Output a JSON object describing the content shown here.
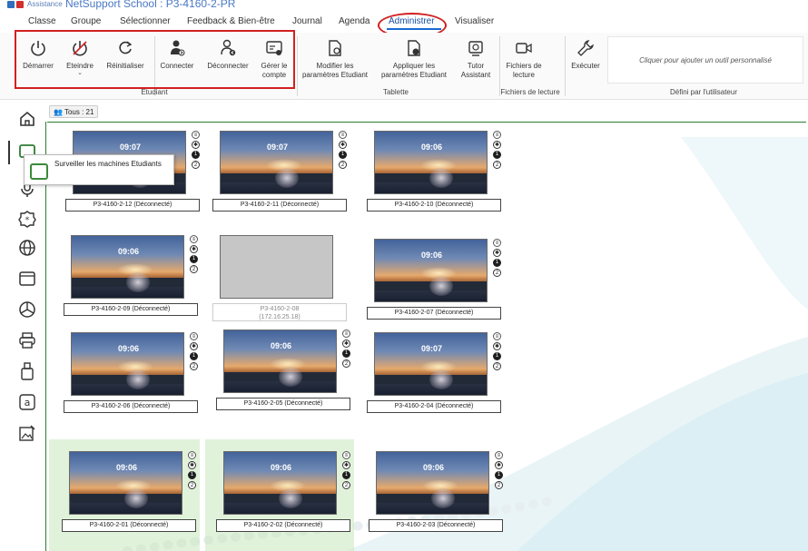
{
  "titlebar": {
    "assist_label": "Assistance",
    "title": "NetSupport School : P3-4160-2-PR"
  },
  "menu": {
    "items": [
      "Classe",
      "Groupe",
      "Sélectionner",
      "Feedback & Bien-être",
      "Journal",
      "Agenda",
      "Administrer",
      "Visualiser"
    ],
    "active": "Administrer"
  },
  "ribbon": {
    "etudiant": {
      "label": "Etudiant",
      "buttons": {
        "demarrer": "Démarrer",
        "eteindre": "Eteindre",
        "reinitialiser": "Réinitialiser",
        "connecter": "Connecter",
        "deconnecter": "Déconnecter",
        "gerer_line1": "Gérer le",
        "gerer_line2": "compte"
      }
    },
    "tablette": {
      "label": "Tablette",
      "buttons": {
        "modifier_line1": "Modifier les",
        "modifier_line2": "paramètres Etudiant",
        "appliquer_line1": "Appliquer les",
        "appliquer_line2": "paramètres Etudiant",
        "tutor_line1": "Tutor",
        "tutor_line2": "Assistant"
      }
    },
    "fichiers": {
      "label": "Fichiers de lecture",
      "button_line1": "Fichiers de",
      "button_line2": "lecture"
    },
    "defini": {
      "label": "Défini par l'utilisateur",
      "executer": "Exécuter",
      "placeholder": "Cliquer pour ajouter un outil personnalisé"
    }
  },
  "tooltip": {
    "text": "Surveiller les machines Etudiants"
  },
  "filter": {
    "label": "Tous : 21"
  },
  "tiles": [
    {
      "time": "09:07",
      "name": "P3-4160-2-12 (Déconnecté)"
    },
    {
      "time": "09:07",
      "name": "P3-4160-2-11 (Déconnecté)"
    },
    {
      "time": "09:06",
      "name": "P3-4160-2-10 (Déconnecté)"
    },
    {
      "time": "09:06",
      "name": "P3-4160-2-09 (Déconnecté)"
    },
    {
      "time": "",
      "name_line1": "P3-4160-2-08",
      "name_line2": "(172.16.25.18)"
    },
    {
      "time": "09:06",
      "name": "P3-4160-2-07 (Déconnecté)"
    },
    {
      "time": "09:06",
      "name": "P3-4160-2-06 (Déconnecté)"
    },
    {
      "time": "09:06",
      "name": "P3-4160-2-05 (Déconnecté)"
    },
    {
      "time": "09:07",
      "name": "P3-4160-2-04 (Déconnecté)"
    },
    {
      "time": "09:06",
      "name": "P3-4160-2-01 (Déconnecté)"
    },
    {
      "time": "09:06",
      "name": "P3-4160-2-02 (Déconnecté)"
    },
    {
      "time": "09:06",
      "name": "P3-4160-2-03 (Déconnecté)"
    }
  ],
  "status_icons": [
    "menu-icon",
    "star-badge-icon",
    "one-badge-icon",
    "two-badge-icon"
  ],
  "colors": {
    "accent": "#1a6bd1",
    "highlight_red": "#d12020",
    "group_green": "#2e7d32"
  }
}
